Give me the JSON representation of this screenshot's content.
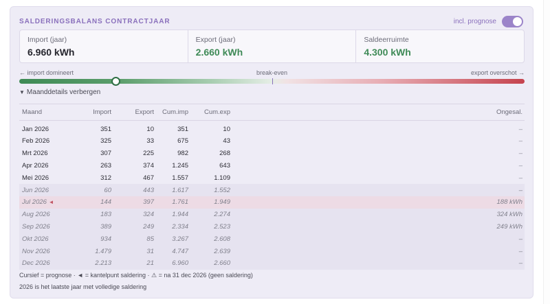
{
  "header": {
    "title": "SALDERINGSBALANS CONTRACTJAAR",
    "toggle_label": "incl. prognose",
    "toggle_on": true
  },
  "stats": {
    "import_label": "Import (jaar)",
    "import_value": "6.960 kWh",
    "export_label": "Export (jaar)",
    "export_value": "2.660 kWh",
    "saldo_label": "Saldeerruimte",
    "saldo_value": "4.300 kWh"
  },
  "gauge": {
    "left_label": "← import domineert",
    "center_label": "break-even",
    "right_label": "export overschot →",
    "marker_fraction": 0.19,
    "colors": {
      "import": "#3e8a55",
      "export": "#c5434e",
      "accent": "#8a70bc"
    }
  },
  "details": {
    "toggle_label": "Maanddetails verbergen",
    "columns": [
      "Maand",
      "Import",
      "Export",
      "Cum.imp",
      "Cum.exp",
      "Ongesal."
    ],
    "rows": [
      {
        "month": "Jan 2026",
        "imp": "351",
        "exp": "10",
        "cimp": "351",
        "cexp": "10",
        "ong": "–",
        "forecast": false,
        "warn": false,
        "tip": false
      },
      {
        "month": "Feb 2026",
        "imp": "325",
        "exp": "33",
        "cimp": "675",
        "cexp": "43",
        "ong": "–",
        "forecast": false,
        "warn": false,
        "tip": false
      },
      {
        "month": "Mrt 2026",
        "imp": "307",
        "exp": "225",
        "cimp": "982",
        "cexp": "268",
        "ong": "–",
        "forecast": false,
        "warn": false,
        "tip": false
      },
      {
        "month": "Apr 2026",
        "imp": "263",
        "exp": "374",
        "cimp": "1.245",
        "cexp": "643",
        "ong": "–",
        "forecast": false,
        "warn": false,
        "tip": false
      },
      {
        "month": "Mei 2026",
        "imp": "312",
        "exp": "467",
        "cimp": "1.557",
        "cexp": "1.109",
        "ong": "–",
        "forecast": false,
        "warn": false,
        "tip": false
      },
      {
        "month": "Jun 2026",
        "imp": "60",
        "exp": "443",
        "cimp": "1.617",
        "cexp": "1.552",
        "ong": "–",
        "forecast": true,
        "warn": false,
        "tip": false
      },
      {
        "month": "Jul 2026",
        "imp": "144",
        "exp": "397",
        "cimp": "1.761",
        "cexp": "1.949",
        "ong": "188 kWh",
        "forecast": true,
        "warn": true,
        "tip": true
      },
      {
        "month": "Aug 2026",
        "imp": "183",
        "exp": "324",
        "cimp": "1.944",
        "cexp": "2.274",
        "ong": "324 kWh",
        "forecast": true,
        "warn": true,
        "tip": false
      },
      {
        "month": "Sep 2026",
        "imp": "389",
        "exp": "249",
        "cimp": "2.334",
        "cexp": "2.523",
        "ong": "249 kWh",
        "forecast": true,
        "warn": true,
        "tip": false
      },
      {
        "month": "Okt 2026",
        "imp": "934",
        "exp": "85",
        "cimp": "3.267",
        "cexp": "2.608",
        "ong": "–",
        "forecast": true,
        "warn": false,
        "tip": false
      },
      {
        "month": "Nov 2026",
        "imp": "1.479",
        "exp": "31",
        "cimp": "4.747",
        "cexp": "2.639",
        "ong": "–",
        "forecast": true,
        "warn": false,
        "tip": false
      },
      {
        "month": "Dec 2026",
        "imp": "2.213",
        "exp": "21",
        "cimp": "6.960",
        "cexp": "2.660",
        "ong": "–",
        "forecast": true,
        "warn": false,
        "tip": false
      }
    ],
    "tip_marker": "◄"
  },
  "footnotes": {
    "line1": "Cursief = prognose · ◄ = kantelpunt saldering · ⚠ = na 31 dec 2026 (geen saldering)",
    "line2": "2026 is het laatste jaar met volledige saldering"
  }
}
